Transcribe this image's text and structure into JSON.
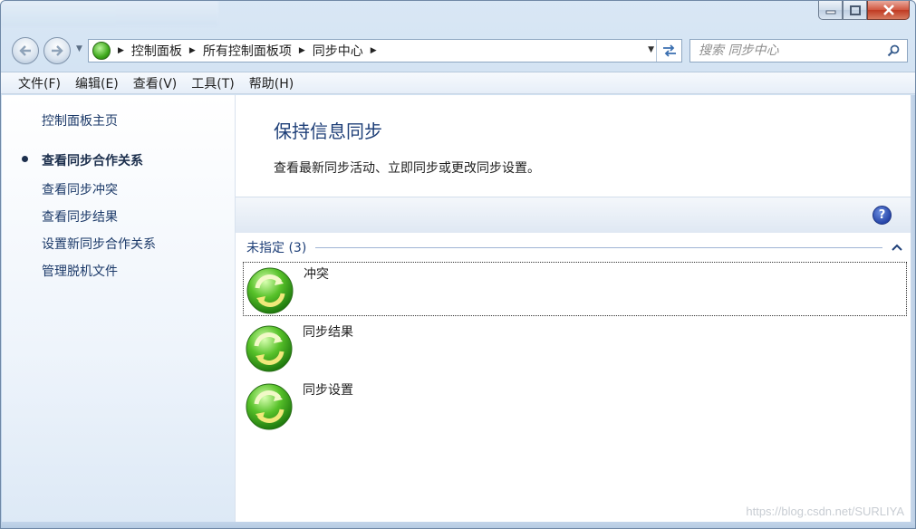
{
  "window": {
    "caption_buttons": [
      "minimize",
      "maximize",
      "close"
    ]
  },
  "nav": {
    "back_icon": "back-arrow-icon",
    "forward_icon": "forward-arrow-icon",
    "breadcrumb": [
      "控制面板",
      "所有控制面板项",
      "同步中心"
    ],
    "search_placeholder": "搜索 同步中心"
  },
  "menu": {
    "items": [
      "文件(F)",
      "编辑(E)",
      "查看(V)",
      "工具(T)",
      "帮助(H)"
    ]
  },
  "sidebar": {
    "home": "控制面板主页",
    "links": [
      "查看同步合作关系",
      "查看同步冲突",
      "查看同步结果",
      "设置新同步合作关系",
      "管理脱机文件"
    ],
    "current_index": 0
  },
  "main": {
    "title": "保持信息同步",
    "description": "查看最新同步活动、立即同步或更改同步设置。",
    "group_label": "未指定 (3)",
    "items": [
      "冲突",
      "同步结果",
      "同步设置"
    ]
  },
  "watermark": "https://blog.csdn.net/SURLIYA",
  "colors": {
    "link": "#1c3a69",
    "title": "#1e3f78",
    "window_frame": "#c9dbee",
    "close_button": "#c03a22"
  }
}
